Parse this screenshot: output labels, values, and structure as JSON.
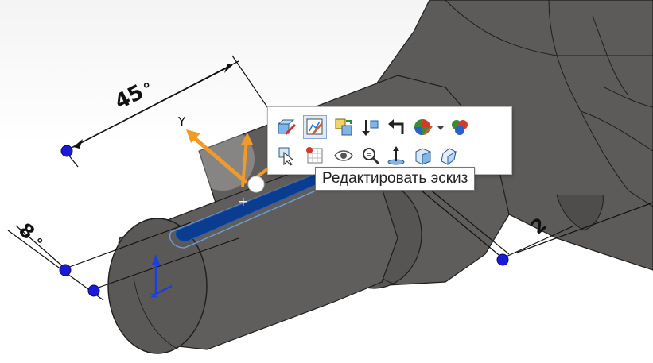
{
  "dimensions": {
    "length_label": "45",
    "offset_label": "8",
    "edge_label": "2"
  },
  "triad": {
    "y_axis_label": "Y"
  },
  "context_toolbar": {
    "row1": [
      "edit-feature",
      "edit-sketch",
      "replace-feature",
      "rollback",
      "parent-child",
      "appearance",
      "appearance-dropdown",
      "display-states"
    ],
    "row2": [
      "select-other",
      "sketch-on-face",
      "hide-show",
      "zoom-to-selection",
      "normal-to",
      "section-view",
      "isolate"
    ]
  },
  "tooltip": {
    "text": "Редактировать эскиз"
  },
  "colors": {
    "part_body": "#5d5b59",
    "part_edge": "#1e1e1e",
    "selection_blue": "#0a3d8f",
    "handle_orange": "#f09a2a",
    "dim_point_blue": "#1a1ad9"
  }
}
